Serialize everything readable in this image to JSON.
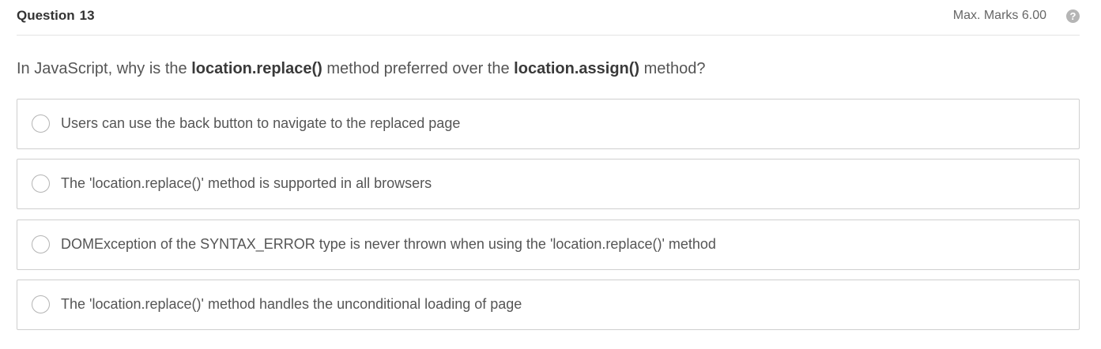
{
  "header": {
    "question_label": "Question",
    "question_number": "13",
    "max_marks": "Max. Marks 6.00",
    "help_icon": "question-circle-icon",
    "help_glyph": "?"
  },
  "question": {
    "prefix": "In JavaScript, why is the ",
    "term1": "location.replace()",
    "middle": " method preferred over the ",
    "term2": "location.assign()",
    "suffix": " method?"
  },
  "options": [
    {
      "label": "Users can use the back button to navigate to the replaced page"
    },
    {
      "label": "The 'location.replace()' method is supported in all browsers"
    },
    {
      "label": "DOMException of the SYNTAX_ERROR type is never thrown when using the 'location.replace()' method"
    },
    {
      "label": "The 'location.replace()' method handles the unconditional loading of page"
    }
  ]
}
